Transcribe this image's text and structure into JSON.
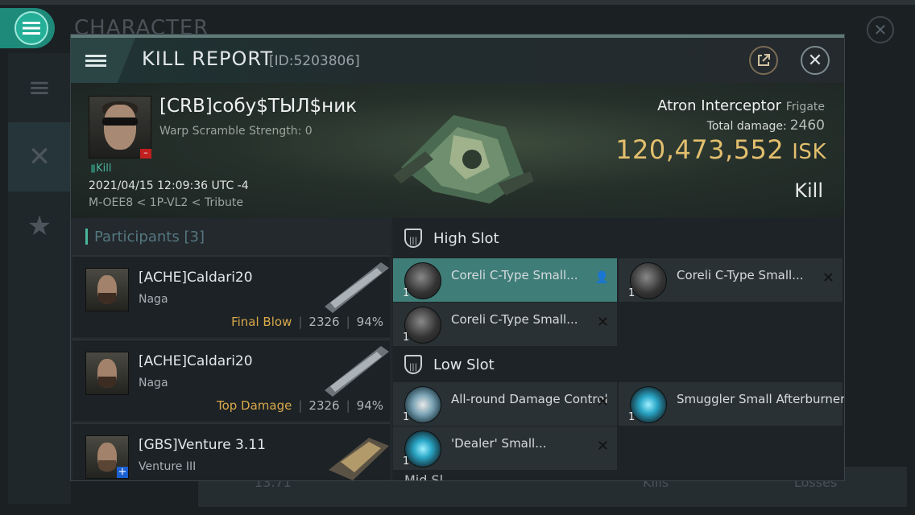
{
  "background": {
    "title": "CHARACTER",
    "bottom_value": "13.71",
    "bottom_kills": "Kills",
    "bottom_losses": "Losses"
  },
  "header": {
    "title": "KILL REPORT",
    "id": "[ID:5203806]"
  },
  "victim": {
    "name": "[CRB]собу$ТЫЛ$ник",
    "warp": "Warp Scramble Strength: 0",
    "tag": "Kill",
    "date": "2021/04/15 12:09:36 UTC -4",
    "location": "M-OEE8 < 1P-VL2 < Tribute",
    "ship_name": "Atron Interceptor",
    "ship_class": "Frigate",
    "total_damage_label": "Total damage:",
    "total_damage": "2460",
    "isk_value": "120,473,552",
    "isk_unit": "ISK",
    "result": "Kill"
  },
  "participants": {
    "label": "Participants",
    "count": "[3]",
    "rows": [
      {
        "name": "[ACHE]Caldari20",
        "ship": "Naga",
        "label": "Final Blow",
        "damage": "2326",
        "percent": "94%"
      },
      {
        "name": "[ACHE]Caldari20",
        "ship": "Naga",
        "label": "Top Damage",
        "damage": "2326",
        "percent": "94%"
      },
      {
        "name": "[GBS]Venture 3.11",
        "ship": "Venture III",
        "label": "",
        "damage": "",
        "percent": ""
      }
    ]
  },
  "fitting": {
    "high_slot": "High Slot",
    "low_slot": "Low Slot",
    "mid_slot": "Mid Sl",
    "high": [
      {
        "name": "Coreli C-Type Small...",
        "qty": "1"
      },
      {
        "name": "Coreli C-Type Small...",
        "qty": "1"
      },
      {
        "name": "Coreli C-Type Small...",
        "qty": "1"
      }
    ],
    "low": [
      {
        "name": "All-round Damage Control",
        "qty": "1"
      },
      {
        "name": "Smuggler Small Afterburner",
        "qty": "1"
      },
      {
        "name": "'Dealer' Small...",
        "qty": "1"
      }
    ]
  },
  "colors": {
    "accent": "#4bb59c",
    "isk": "#e2bf6e",
    "final_blow": "#d9a94b"
  }
}
